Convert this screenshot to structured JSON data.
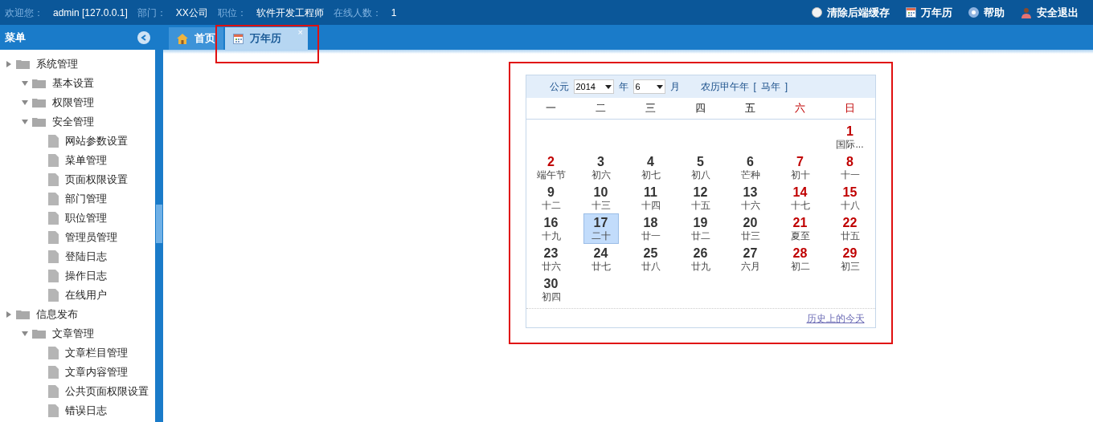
{
  "top_bar": {
    "info": [
      {
        "label": "欢迎您：",
        "value": "admin [127.0.0.1]"
      },
      {
        "label": "部门：",
        "value": "XX公司"
      },
      {
        "label": "职位：",
        "value": "软件开发工程师"
      },
      {
        "label": "在线人数：",
        "value": "1"
      }
    ],
    "actions": [
      {
        "kind": "clear",
        "label": "清除后端缓存"
      },
      {
        "kind": "calendar",
        "label": "万年历"
      },
      {
        "kind": "help",
        "label": "帮助"
      },
      {
        "kind": "logout",
        "label": "安全退出"
      }
    ]
  },
  "sidebar": {
    "title": "菜单",
    "items": [
      {
        "label": "系统管理",
        "expanded": false,
        "children": [
          {
            "label": "基本设置",
            "expanded": true
          },
          {
            "label": "权限管理",
            "expanded": true
          },
          {
            "label": "安全管理",
            "expanded": true,
            "children": [
              {
                "label": "网站参数设置"
              },
              {
                "label": "菜单管理"
              },
              {
                "label": "页面权限设置"
              },
              {
                "label": "部门管理"
              },
              {
                "label": "职位管理"
              },
              {
                "label": "管理员管理"
              },
              {
                "label": "登陆日志"
              },
              {
                "label": "操作日志"
              },
              {
                "label": "在线用户"
              }
            ]
          }
        ]
      },
      {
        "label": "信息发布",
        "expanded": false,
        "children": [
          {
            "label": "文章管理",
            "expanded": true,
            "children": [
              {
                "label": "文章栏目管理"
              },
              {
                "label": "文章内容管理"
              },
              {
                "label": "公共页面权限设置"
              },
              {
                "label": "错误日志"
              }
            ]
          }
        ]
      }
    ]
  },
  "tabs": [
    {
      "kind": "home",
      "label": "首页",
      "selected": false
    },
    {
      "kind": "calendar",
      "label": "万年历",
      "selected": true,
      "close": "×"
    }
  ],
  "calendar": {
    "era": "公元",
    "year": "2014",
    "year_unit": "年",
    "month": "6",
    "month_unit": "月",
    "lunar_year": "农历甲午年",
    "zodiac_open": "[",
    "zodiac": "马年",
    "zodiac_close": "]",
    "weekdays": [
      {
        "label": "一",
        "weekend": false
      },
      {
        "label": "二",
        "weekend": false
      },
      {
        "label": "三",
        "weekend": false
      },
      {
        "label": "四",
        "weekend": false
      },
      {
        "label": "五",
        "weekend": false
      },
      {
        "label": "六",
        "weekend": true
      },
      {
        "label": "日",
        "weekend": true
      }
    ],
    "weeks": [
      {
        "kind": "end_aligned",
        "days": [
          {
            "day": "1",
            "lunar": "国际...",
            "holiday": true,
            "selected": false
          }
        ]
      },
      {
        "kind": "start_aligned",
        "days": [
          {
            "day": "2",
            "lunar": "端午节",
            "holiday": true,
            "selected": false
          },
          {
            "day": "3",
            "lunar": "初六",
            "holiday": false,
            "selected": false
          },
          {
            "day": "4",
            "lunar": "初七",
            "holiday": false,
            "selected": false
          },
          {
            "day": "5",
            "lunar": "初八",
            "holiday": false,
            "selected": false
          },
          {
            "day": "6",
            "lunar": "芒种",
            "holiday": false,
            "selected": false
          },
          {
            "day": "7",
            "lunar": "初十",
            "holiday": true,
            "selected": false
          },
          {
            "day": "8",
            "lunar": "十一",
            "holiday": true,
            "selected": false
          }
        ]
      },
      {
        "kind": "start_aligned",
        "days": [
          {
            "day": "9",
            "lunar": "十二",
            "holiday": false,
            "selected": false
          },
          {
            "day": "10",
            "lunar": "十三",
            "holiday": false,
            "selected": false
          },
          {
            "day": "11",
            "lunar": "十四",
            "holiday": false,
            "selected": false
          },
          {
            "day": "12",
            "lunar": "十五",
            "holiday": false,
            "selected": false
          },
          {
            "day": "13",
            "lunar": "十六",
            "holiday": false,
            "selected": false
          },
          {
            "day": "14",
            "lunar": "十七",
            "holiday": true,
            "selected": false
          },
          {
            "day": "15",
            "lunar": "十八",
            "holiday": true,
            "selected": false
          }
        ]
      },
      {
        "kind": "start_aligned",
        "days": [
          {
            "day": "16",
            "lunar": "十九",
            "holiday": false,
            "selected": false
          },
          {
            "day": "17",
            "lunar": "二十",
            "holiday": false,
            "selected": true
          },
          {
            "day": "18",
            "lunar": "廿一",
            "holiday": false,
            "selected": false
          },
          {
            "day": "19",
            "lunar": "廿二",
            "holiday": false,
            "selected": false
          },
          {
            "day": "20",
            "lunar": "廿三",
            "holiday": false,
            "selected": false
          },
          {
            "day": "21",
            "lunar": "夏至",
            "holiday": true,
            "selected": false
          },
          {
            "day": "22",
            "lunar": "廿五",
            "holiday": true,
            "selected": false
          }
        ]
      },
      {
        "kind": "start_aligned",
        "days": [
          {
            "day": "23",
            "lunar": "廿六",
            "holiday": false,
            "selected": false
          },
          {
            "day": "24",
            "lunar": "廿七",
            "holiday": false,
            "selected": false
          },
          {
            "day": "25",
            "lunar": "廿八",
            "holiday": false,
            "selected": false
          },
          {
            "day": "26",
            "lunar": "廿九",
            "holiday": false,
            "selected": false
          },
          {
            "day": "27",
            "lunar": "六月",
            "holiday": false,
            "selected": false
          },
          {
            "day": "28",
            "lunar": "初二",
            "holiday": true,
            "selected": false
          },
          {
            "day": "29",
            "lunar": "初三",
            "holiday": true,
            "selected": false
          }
        ]
      },
      {
        "kind": "start_aligned",
        "days": [
          {
            "day": "30",
            "lunar": "初四",
            "holiday": false,
            "selected": false
          }
        ]
      }
    ],
    "footer_link": "历史上的今天"
  }
}
